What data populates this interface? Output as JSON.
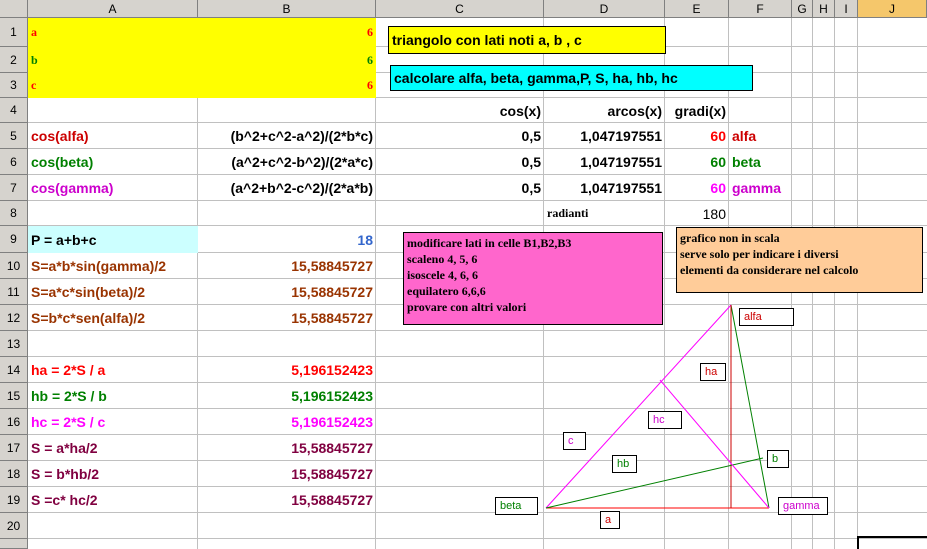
{
  "columns": [
    "A",
    "B",
    "C",
    "D",
    "E",
    "F",
    "G",
    "H",
    "I",
    "J"
  ],
  "rows": [
    "1",
    "2",
    "3",
    "4",
    "5",
    "6",
    "7",
    "8",
    "9",
    "10",
    "11",
    "12",
    "13",
    "14",
    "15",
    "16",
    "17",
    "18",
    "19",
    "20"
  ],
  "inputs": {
    "a_label": "a",
    "a_value": "6",
    "b_label": "b",
    "b_value": "6",
    "c_label": "c",
    "c_value": "6"
  },
  "titles": {
    "title1": "triangolo con lati noti a, b , c",
    "title2": "calcolare alfa, beta, gamma,P, S, ha, hb, hc"
  },
  "headers": {
    "cos": "cos(x)",
    "arcos": "arcos(x)",
    "gradi": "gradi(x)"
  },
  "angles": [
    {
      "name": "cos(alfa)",
      "formula": "(b^2+c^2-a^2)/(2*b*c)",
      "cos": "0,5",
      "arcos": "1,047197551",
      "deg": "60",
      "label": "alfa"
    },
    {
      "name": "cos(beta)",
      "formula": "(a^2+c^2-b^2)/(2*a*c)",
      "cos": "0,5",
      "arcos": "1,047197551",
      "deg": "60",
      "label": "beta"
    },
    {
      "name": "cos(gamma)",
      "formula": "(a^2+b^2-c^2)/(2*a*b)",
      "cos": "0,5",
      "arcos": "1,047197551",
      "deg": "60",
      "label": "gamma"
    }
  ],
  "radianti": {
    "label": "radianti",
    "value": "180"
  },
  "perimeter": {
    "label": "P = a+b+c",
    "value": "18"
  },
  "areas": [
    {
      "label": "S=a*b*sin(gamma)/2",
      "value": "15,58845727"
    },
    {
      "label": "S=a*c*sin(beta)/2",
      "value": "15,58845727"
    },
    {
      "label": "S=b*c*sen(alfa)/2",
      "value": "15,58845727"
    }
  ],
  "heights": [
    {
      "label": "ha = 2*S / a",
      "value": "5,196152423"
    },
    {
      "label": "hb = 2*S / b",
      "value": "5,196152423"
    },
    {
      "label": "hc = 2*S / c",
      "value": "5,196152423"
    }
  ],
  "areas2": [
    {
      "label": "S = a*ha/2",
      "value": "15,58845727"
    },
    {
      "label": "S = b*hb/2",
      "value": "15,58845727"
    },
    {
      "label": "S =c* hc/2",
      "value": "15,58845727"
    }
  ],
  "note_pink": [
    "modificare lati in celle B1,B2,B3",
    "scaleno 4, 5, 6",
    "isoscele 4, 6, 6",
    "equilatero 6,6,6",
    "provare con altri valori"
  ],
  "note_orange": [
    "grafico non in scala",
    "serve solo per indicare i diversi",
    "elementi da considerare nel calcolo"
  ],
  "diagram_labels": {
    "alfa": "alfa",
    "beta": "beta",
    "gamma": "gamma",
    "a": "a",
    "b": "b",
    "c": "c",
    "ha": "ha",
    "hb": "hb",
    "hc": "hc"
  },
  "colors": {
    "red": "#ff0000",
    "green": "#008000",
    "magenta": "#ff00ff",
    "brown": "#993300",
    "purple": "#800040",
    "yellow": "#ffff00",
    "cyan": "#00ffff",
    "lightcyan": "#ccffff",
    "pink": "#ff66cc",
    "orange": "#ffcc99",
    "darkred": "#cc0000"
  }
}
